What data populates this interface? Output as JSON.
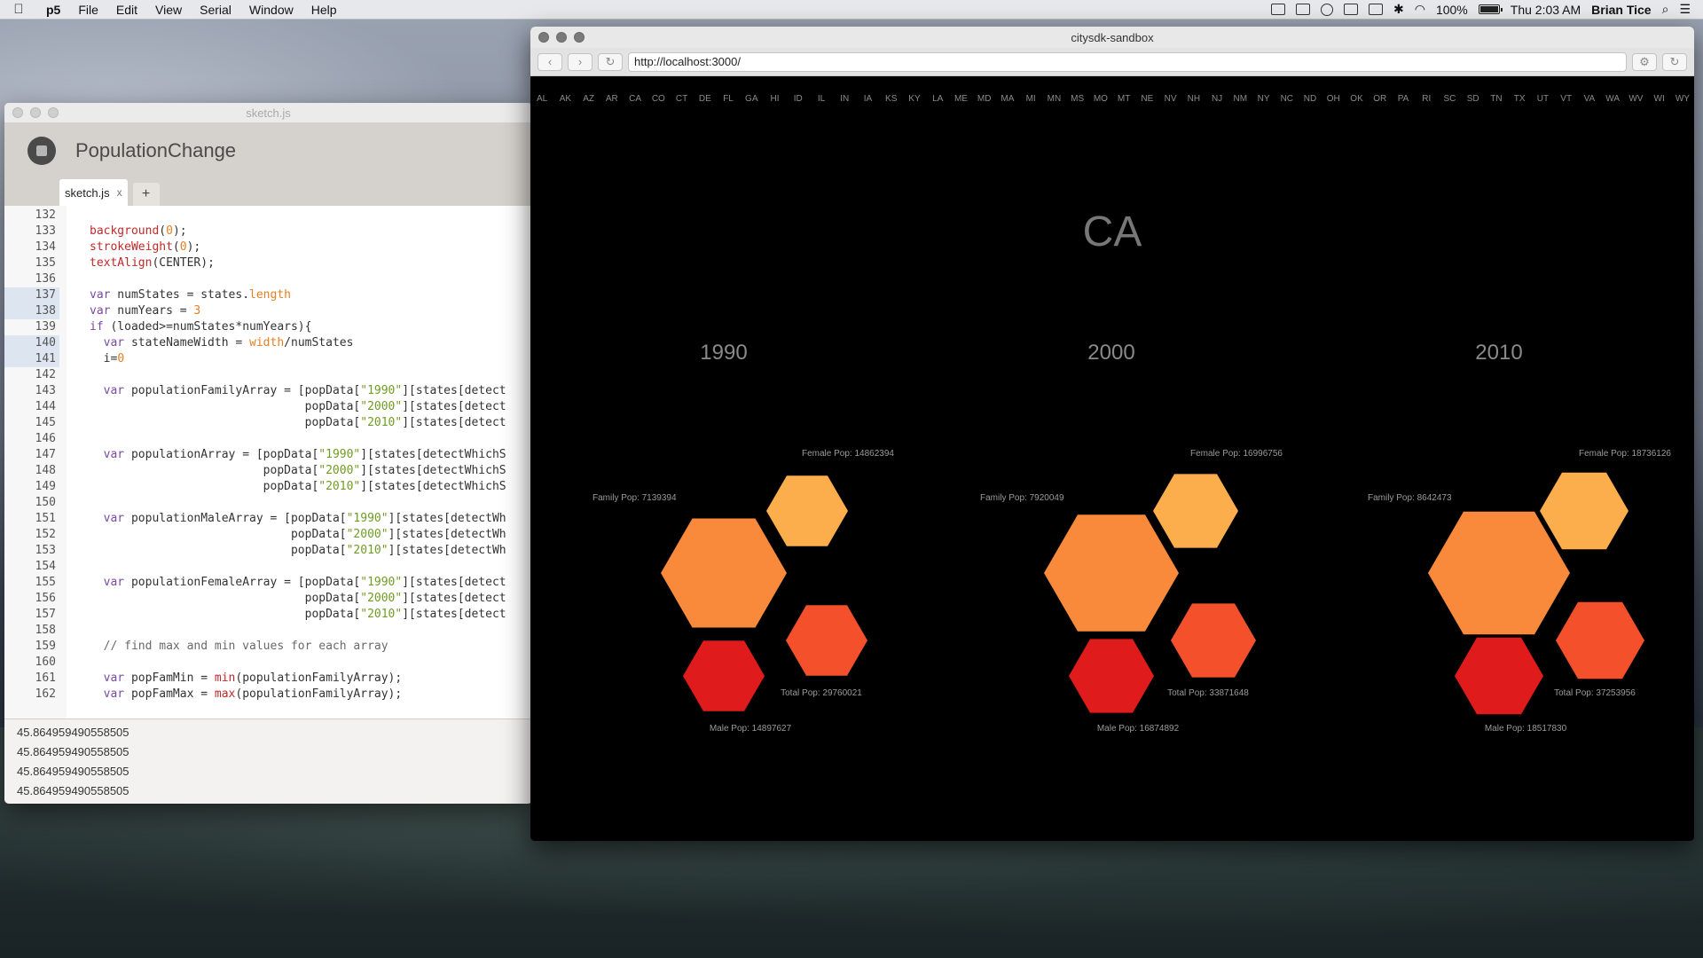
{
  "menubar": {
    "app": "p5",
    "items": [
      "File",
      "Edit",
      "View",
      "Serial",
      "Window",
      "Help"
    ],
    "battery": "100%",
    "clock": "Thu 2:03 AM",
    "user": "Brian Tice"
  },
  "editor": {
    "window_title": "sketch.js",
    "project_name": "PopulationChange",
    "tab_label": "sketch.js",
    "tab_close": "x",
    "add_tab": "+",
    "lines": [
      {
        "n": "132",
        "t": ""
      },
      {
        "n": "133",
        "t": "background(0);"
      },
      {
        "n": "134",
        "t": "strokeWeight(0);"
      },
      {
        "n": "135",
        "t": "textAlign(CENTER);"
      },
      {
        "n": "136",
        "t": ""
      },
      {
        "n": "137",
        "t": "var numStates = states.length"
      },
      {
        "n": "138",
        "t": "var numYears = 3"
      },
      {
        "n": "139",
        "t": "if (loaded>=numStates*numYears){"
      },
      {
        "n": "140",
        "t": "  var stateNameWidth = width/numStates"
      },
      {
        "n": "141",
        "t": "  i=0"
      },
      {
        "n": "142",
        "t": ""
      },
      {
        "n": "143",
        "t": "  var populationFamilyArray = [popData[\"1990\"][states[detect"
      },
      {
        "n": "144",
        "t": "                               popData[\"2000\"][states[detect"
      },
      {
        "n": "145",
        "t": "                               popData[\"2010\"][states[detect"
      },
      {
        "n": "146",
        "t": ""
      },
      {
        "n": "147",
        "t": "  var populationArray = [popData[\"1990\"][states[detectWhichS"
      },
      {
        "n": "148",
        "t": "                         popData[\"2000\"][states[detectWhichS"
      },
      {
        "n": "149",
        "t": "                         popData[\"2010\"][states[detectWhichS"
      },
      {
        "n": "150",
        "t": ""
      },
      {
        "n": "151",
        "t": "  var populationMaleArray = [popData[\"1990\"][states[detectWh"
      },
      {
        "n": "152",
        "t": "                             popData[\"2000\"][states[detectWh"
      },
      {
        "n": "153",
        "t": "                             popData[\"2010\"][states[detectWh"
      },
      {
        "n": "154",
        "t": ""
      },
      {
        "n": "155",
        "t": "  var populationFemaleArray = [popData[\"1990\"][states[detect"
      },
      {
        "n": "156",
        "t": "                               popData[\"2000\"][states[detect"
      },
      {
        "n": "157",
        "t": "                               popData[\"2010\"][states[detect"
      },
      {
        "n": "158",
        "t": ""
      },
      {
        "n": "159",
        "t": "  // find max and min values for each array"
      },
      {
        "n": "160",
        "t": ""
      },
      {
        "n": "161",
        "t": "  var popFamMin = min(populationFamilyArray);"
      },
      {
        "n": "162",
        "t": "  var popFamMax = max(populationFamilyArray);"
      }
    ],
    "console": [
      "45.864959490558505",
      "45.864959490558505",
      "45.864959490558505",
      "45.864959490558505"
    ]
  },
  "browser": {
    "window_title": "citysdk-sandbox",
    "url": "http://localhost:3000/",
    "back": "‹",
    "forward": "›",
    "reload": "↻",
    "gear": "⚙",
    "states": [
      "AL",
      "AK",
      "AZ",
      "AR",
      "CA",
      "CO",
      "CT",
      "DE",
      "FL",
      "GA",
      "HI",
      "ID",
      "IL",
      "IN",
      "IA",
      "KS",
      "KY",
      "LA",
      "ME",
      "MD",
      "MA",
      "MI",
      "MN",
      "MS",
      "MO",
      "MT",
      "NE",
      "NV",
      "NH",
      "NJ",
      "NM",
      "NY",
      "NC",
      "ND",
      "OH",
      "OK",
      "OR",
      "PA",
      "RI",
      "SC",
      "SD",
      "TN",
      "TX",
      "UT",
      "VT",
      "VA",
      "WA",
      "WV",
      "WI",
      "WY"
    ],
    "selected_state": "CA",
    "colors": {
      "family": "#f98a3c",
      "female": "#fcae4c",
      "total": "#f5502c",
      "male": "#e01b1b"
    },
    "years": [
      {
        "year": "1990",
        "female": "Female Pop: 14862394",
        "family": "Family Pop: 7139394",
        "total": "Total Pop: 29760021",
        "male": "Male Pop: 14897627"
      },
      {
        "year": "2000",
        "female": "Female Pop: 16996756",
        "family": "Family Pop: 7920049",
        "total": "Total Pop: 33871648",
        "male": "Male Pop: 16874892"
      },
      {
        "year": "2010",
        "female": "Female Pop: 18736126",
        "family": "Family Pop: 8642473",
        "total": "Total Pop: 37253956",
        "male": "Male Pop: 18517830"
      }
    ]
  }
}
